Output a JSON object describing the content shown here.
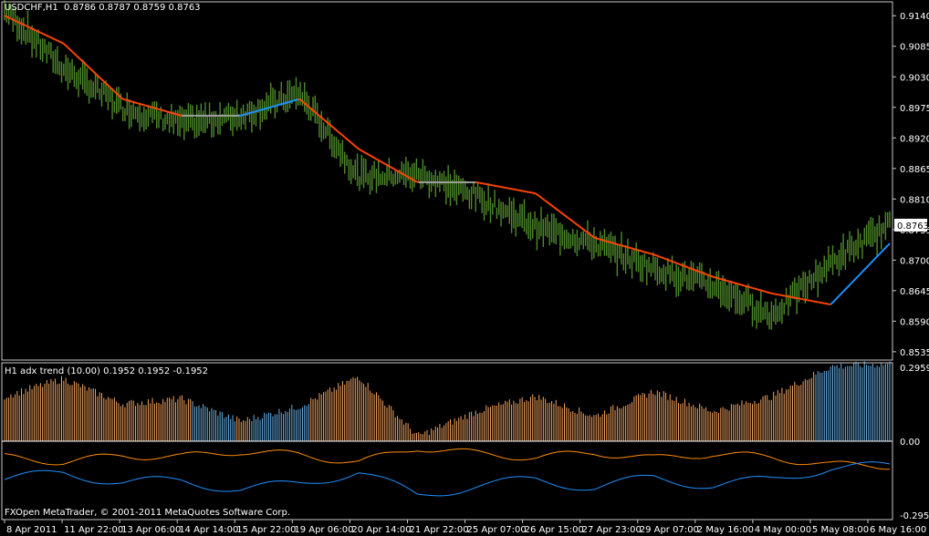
{
  "price_panel": {
    "symbol": "USDCHF,H1",
    "ohlc": "0.8786 0.8787 0.8759 0.8763",
    "y_labels": [
      "0.9140",
      "0.9085",
      "0.9030",
      "0.8975",
      "0.8920",
      "0.8865",
      "0.8810",
      "0.8755",
      "0.8700",
      "0.8645",
      "0.8590",
      "0.8535"
    ],
    "current_price": "0.8763"
  },
  "indicator_panel": {
    "title": "H1 adx trend (10.00)",
    "values": "0.1952 0.1952 -0.1952",
    "y_labels": [
      "0.2959",
      "0.00",
      "-0.2959"
    ]
  },
  "x_labels": [
    "8 Apr 2011",
    "11 Apr 22:00",
    "13 Apr 06:00",
    "14 Apr 14:00",
    "15 Apr 22:00",
    "19 Apr 06:00",
    "20 Apr 14:00",
    "21 Apr 22:00",
    "25 Apr 07:00",
    "26 Apr 15:00",
    "27 Apr 23:00",
    "29 Apr 07:00",
    "2 May 16:00",
    "4 May 00:00",
    "5 May 08:00",
    "6 May 16:00"
  ],
  "copyright": "FXOpen MetaTrader, © 2001-2011 MetaQuotes Software Corp.",
  "colors": {
    "background": "#000000",
    "bars": "#4e8a2a",
    "ma_down": "#ff4500",
    "ma_flat": "#a0a0a0",
    "ma_up": "#1e90ff",
    "hist_pos": "#f4a460",
    "hist_neg": "#6ab0e6",
    "line_orange": "#ff8c00",
    "line_blue": "#1e90ff",
    "frame": "#c8c8c8"
  },
  "chart_data": [
    {
      "type": "line",
      "series": [
        {
          "name": "USDCHF,H1",
          "x": [
            "8 Apr 2011",
            "11 Apr 22:00",
            "13 Apr 06:00",
            "14 Apr 14:00",
            "15 Apr 22:00",
            "19 Apr 06:00",
            "20 Apr 14:00",
            "21 Apr 22:00",
            "25 Apr 07:00",
            "26 Apr 15:00",
            "27 Apr 23:00",
            "29 Apr 07:00",
            "2 May 16:00",
            "4 May 00:00",
            "5 May 08:00",
            "6 May 16:00"
          ],
          "values": [
            0.915,
            0.9045,
            0.8975,
            0.8945,
            0.896,
            0.9,
            0.885,
            0.8855,
            0.8815,
            0.876,
            0.873,
            0.8685,
            0.8655,
            0.86,
            0.8695,
            0.8763
          ]
        },
        {
          "name": "trend line",
          "x": [
            "8 Apr 2011",
            "11 Apr 22:00",
            "13 Apr 06:00",
            "14 Apr 14:00",
            "15 Apr 22:00",
            "19 Apr 06:00",
            "20 Apr 14:00",
            "21 Apr 22:00",
            "25 Apr 07:00",
            "26 Apr 15:00",
            "27 Apr 23:00",
            "29 Apr 07:00",
            "2 May 16:00",
            "4 May 00:00",
            "5 May 08:00",
            "6 May 16:00"
          ],
          "values": [
            0.914,
            0.909,
            0.899,
            0.896,
            0.896,
            0.899,
            0.89,
            0.884,
            0.884,
            0.882,
            0.874,
            0.871,
            0.867,
            0.864,
            0.862,
            0.873
          ]
        }
      ],
      "ylim": [
        0.852,
        0.9165
      ]
    },
    {
      "type": "bar",
      "series": [
        {
          "name": "H1 adx trend (10.00)",
          "x": [
            "8 Apr 2011",
            "11 Apr 22:00",
            "13 Apr 06:00",
            "14 Apr 14:00",
            "15 Apr 22:00",
            "19 Apr 06:00",
            "20 Apr 14:00",
            "21 Apr 22:00",
            "25 Apr 07:00",
            "26 Apr 15:00",
            "27 Apr 23:00",
            "29 Apr 07:00",
            "2 May 16:00",
            "4 May 00:00",
            "5 May 08:00",
            "6 May 16:00"
          ],
          "values": [
            0.18,
            0.25,
            0.15,
            0.17,
            0.08,
            0.14,
            0.26,
            0.02,
            0.12,
            0.18,
            0.1,
            0.2,
            0.12,
            0.18,
            0.3,
            0.31
          ]
        }
      ],
      "ylim": [
        -0.2959,
        0.2959
      ]
    }
  ]
}
